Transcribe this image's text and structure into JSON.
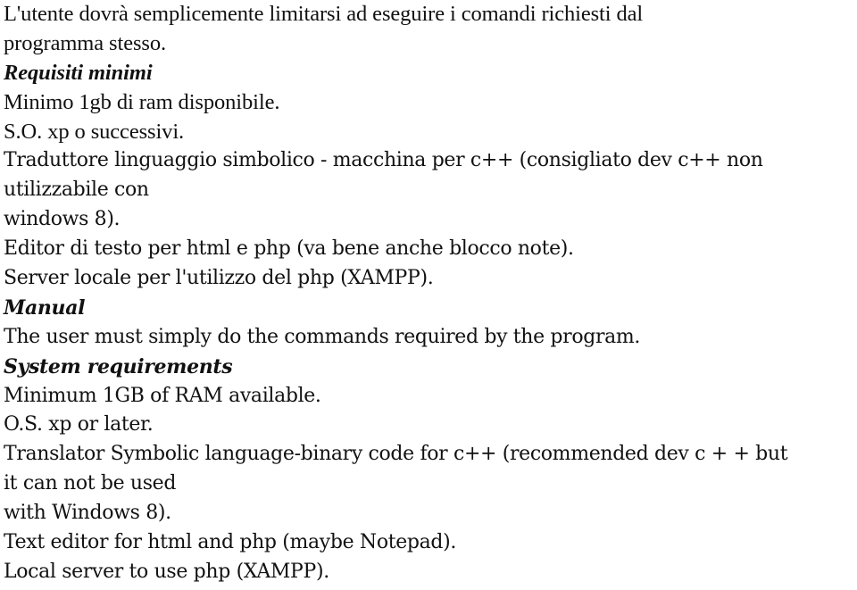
{
  "document": {
    "italian": {
      "intro_line1": "L'utente dovrà semplicemente limitarsi ad eseguire i comandi richiesti dal",
      "intro_line2": "programma stesso.",
      "requirements_heading": "Requisiti minimi",
      "req_ram": "Minimo 1gb di ram disponibile.",
      "req_os": "S.O. xp o successivi.",
      "req_translator_line1": "Traduttore linguaggio simbolico - macchina per c++ (consigliato dev c++ non",
      "req_translator_line2": "utilizzabile con",
      "req_translator_line3": "windows 8).",
      "req_editor": "Editor di testo per html e php (va bene anche blocco note).",
      "req_server": "Server locale per l'utilizzo del php (XAMPP)."
    },
    "english": {
      "manual_heading": "Manual",
      "manual_text": "The user must simply do the commands required by the program.",
      "requirements_heading": "System requirements",
      "req_ram": "Minimum 1GB of RAM available.",
      "req_os": "O.S. xp or later.",
      "req_translator_line1": "Translator Symbolic language-binary code for c++ (recommended dev c + + but",
      "req_translator_line2": "it can not be used",
      "req_translator_line3": "with Windows 8).",
      "req_editor": "Text editor for html and php (maybe Notepad).",
      "req_server": "Local server to use php (XAMPP)."
    }
  }
}
